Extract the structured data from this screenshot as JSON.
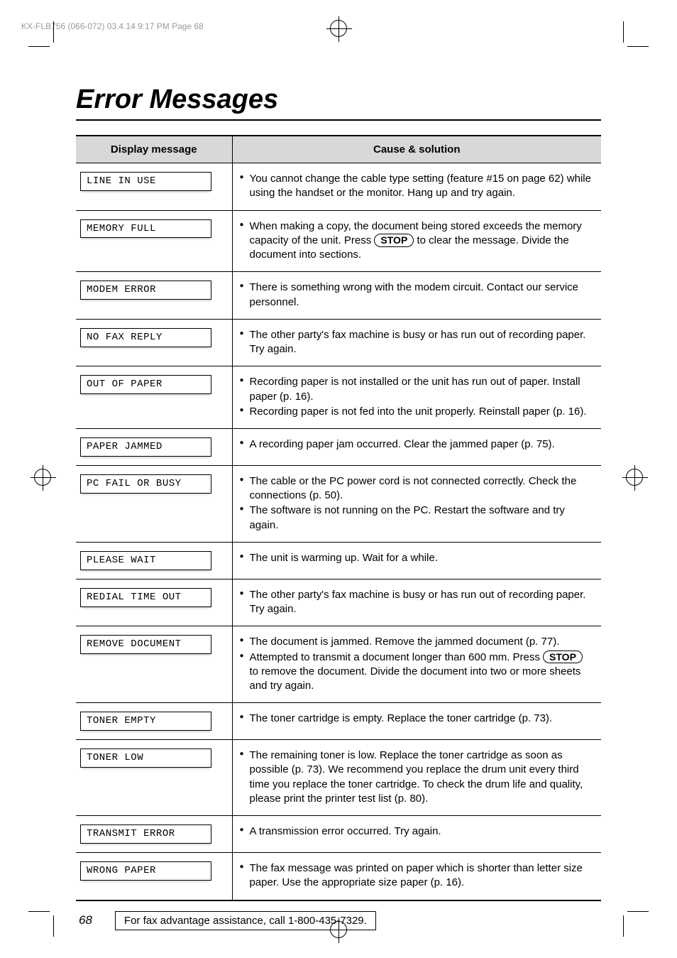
{
  "meta": {
    "header": "KX-FLB756 (066-072)  03.4.14  9:17 PM  Page 68"
  },
  "title": "Error Messages",
  "table": {
    "header_left": "Display message",
    "header_right": "Cause & solution",
    "rows": [
      {
        "display": "LINE IN USE",
        "items": [
          {
            "text": "You cannot change the cable type setting (feature #15 on page 62) while using the handset or the monitor. Hang up and try again."
          }
        ]
      },
      {
        "display": "MEMORY FULL",
        "items": [
          {
            "pre": "When making a copy, the document being stored exceeds the memory capacity of the unit. Press ",
            "button": "STOP",
            "post": " to clear the message. Divide the document into sections."
          }
        ]
      },
      {
        "display": "MODEM ERROR",
        "items": [
          {
            "text": "There is something wrong with the modem circuit. Contact our service personnel."
          }
        ]
      },
      {
        "display": "NO FAX REPLY",
        "items": [
          {
            "text": "The other party's fax machine is busy or has run out of recording paper. Try again."
          }
        ]
      },
      {
        "display": "OUT OF PAPER",
        "items": [
          {
            "text": "Recording paper is not installed or the unit has run out of paper. Install paper (p. 16)."
          },
          {
            "text": "Recording paper is not fed into the unit properly. Reinstall paper (p. 16)."
          }
        ]
      },
      {
        "display": "PAPER JAMMED",
        "items": [
          {
            "text": "A recording paper jam occurred. Clear the jammed paper (p. 75)."
          }
        ]
      },
      {
        "display": "PC FAIL OR BUSY",
        "items": [
          {
            "text": "The cable or the PC power cord is not connected correctly. Check the connections (p. 50)."
          },
          {
            "text": "The software is not running on the PC. Restart the software and try again."
          }
        ]
      },
      {
        "display": "PLEASE WAIT",
        "items": [
          {
            "text": "The unit is warming up. Wait for a while."
          }
        ]
      },
      {
        "display": "REDIAL TIME OUT",
        "items": [
          {
            "text": "The other party's fax machine is busy or has run out of recording paper. Try again."
          }
        ]
      },
      {
        "display": "REMOVE DOCUMENT",
        "items": [
          {
            "text": "The document is jammed. Remove the jammed document (p. 77)."
          },
          {
            "pre": "Attempted to transmit a document longer than 600 mm. Press ",
            "button": "STOP",
            "post": " to remove the document. Divide the document into two or more sheets and try again."
          }
        ]
      },
      {
        "display": "TONER EMPTY",
        "items": [
          {
            "text": "The toner cartridge is empty. Replace the toner cartridge (p. 73)."
          }
        ]
      },
      {
        "display": "TONER LOW",
        "items": [
          {
            "text": "The remaining toner is low. Replace the toner cartridge as soon as possible (p. 73). We recommend you replace the drum unit every third time you replace the toner cartridge. To check the drum life and quality, please print the printer test list (p. 80)."
          }
        ]
      },
      {
        "display": "TRANSMIT ERROR",
        "items": [
          {
            "text": "A transmission error occurred. Try again."
          }
        ]
      },
      {
        "display": "WRONG PAPER",
        "items": [
          {
            "text": "The fax message was printed on paper which is shorter than letter size paper. Use the appropriate size paper (p. 16)."
          }
        ]
      }
    ]
  },
  "footer": {
    "page": "68",
    "assist": "For fax advantage assistance, call 1-800-435-7329."
  }
}
